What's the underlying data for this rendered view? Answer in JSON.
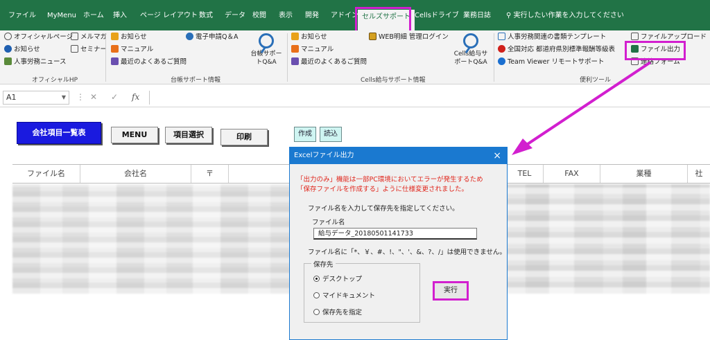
{
  "tabs": [
    {
      "label": "ファイル"
    },
    {
      "label": "MyMenu"
    },
    {
      "label": "ホーム"
    },
    {
      "label": "挿入"
    },
    {
      "label": "ページ レイアウト"
    },
    {
      "label": "数式"
    },
    {
      "label": "データ"
    },
    {
      "label": "校閲"
    },
    {
      "label": "表示"
    },
    {
      "label": "開発"
    },
    {
      "label": "アドイン"
    },
    {
      "label": "セルズサポート"
    },
    {
      "label": "Cellsドライブ"
    },
    {
      "label": "業務日誌"
    }
  ],
  "tell_me": "実行したい作業を入力してください",
  "ribbon": {
    "official": {
      "items": [
        "オフィシャルページ",
        "メルマガ",
        "お知らせ",
        "セミナー",
        "人事労務ニュース"
      ],
      "label": "オフィシャルHP"
    },
    "daicho": {
      "items": [
        "お知らせ",
        "マニュアル",
        "最近のよくあるご質問",
        "電子申請Q＆A"
      ],
      "big_label": "台帳サポートQ&A",
      "label": "台帳サポート情報"
    },
    "cells": {
      "items": [
        "お知らせ",
        "マニュアル",
        "最近のよくあるご質問",
        "WEB明細 管理ログイン"
      ],
      "big_label": "Cells給与サポートQ&A",
      "label": "Cells給与サポート情報"
    },
    "tools": {
      "items": [
        "人事労務関連の書類テンプレート",
        "全国対応 都道府県別標準報酬等級表",
        "Team Viewer リモートサポート",
        "ファイルアップロード",
        "ファイル出力",
        "連絡フォーム"
      ],
      "label": "便利ツール"
    }
  },
  "formula_bar": {
    "cell": "A1",
    "fx": "fx"
  },
  "sheet": {
    "buttons": {
      "company_list": "会社項目一覧表",
      "menu": "MENU",
      "item_select": "項目選択",
      "print": "印刷",
      "create": "作成",
      "load": "読込"
    },
    "headers": [
      "ファイル名",
      "会社名",
      "〒",
      "TEL",
      "FAX",
      "業種",
      "社"
    ]
  },
  "dialog": {
    "title": "Excelファイル出力",
    "close": "×",
    "warning_line1": "「出力のみ」機能は一部PC環境においてエラーが発生するため",
    "warning_line2": "「保存ファイルを作成する」ように仕様変更されました。",
    "instruction": "ファイル名を入力して保存先を指定してください。",
    "filename_label": "ファイル名",
    "filename_value": "給与データ_20180501141733",
    "note": "ファイル名に「*、￥、#、!、\"、'、&、?、/」は使用できません。",
    "dest_legend": "保存先",
    "options": [
      "デスクトップ",
      "マイドキュメント",
      "保存先を指定"
    ],
    "selected_option": "デスクトップ",
    "execute": "実行"
  },
  "colors": {
    "excel_green": "#217346",
    "highlight": "#d21fcf",
    "dialog_blue": "#1a79d0",
    "warning_red": "#e0261c",
    "primary_button": "#1a1adf"
  }
}
